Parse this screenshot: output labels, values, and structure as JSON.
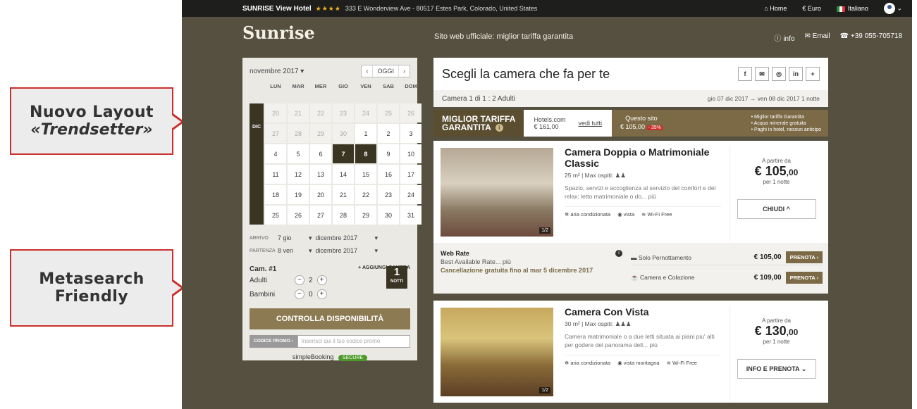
{
  "callouts": [
    {
      "line1": "Nuovo Layout",
      "line2": "«Trendsetter»"
    },
    {
      "line1": "Metasearch",
      "line2": "Friendly"
    }
  ],
  "topbar": {
    "hotel": "SUNRISE View Hotel",
    "stars": "★★★★",
    "address": "333 E Wonderview Ave - 80517 Estes Park, Colorado, United States",
    "home": "Home",
    "currency": "€ Euro",
    "language": "Italiano"
  },
  "header": {
    "logo": "Sunrise",
    "tagline": "Sito web ufficiale: miglior tariffa garantita",
    "info": "info",
    "email": "Email",
    "phone": "+39 055-705718"
  },
  "calendar": {
    "month_select": "novembre 2017",
    "today_btn": "OGGI",
    "prev": "‹",
    "next": "›",
    "dow": [
      "LUN",
      "MAR",
      "MER",
      "GIO",
      "VEN",
      "SAB",
      "DOM"
    ],
    "month_label": "DIC",
    "weeks": [
      [
        "20",
        "21",
        "22",
        "23",
        "24",
        "25",
        "26"
      ],
      [
        "27",
        "28",
        "29",
        "30",
        "1",
        "2",
        "3"
      ],
      [
        "4",
        "5",
        "6",
        "7",
        "8",
        "9",
        "10"
      ],
      [
        "11",
        "12",
        "13",
        "14",
        "15",
        "16",
        "17"
      ],
      [
        "18",
        "19",
        "20",
        "21",
        "22",
        "23",
        "24"
      ],
      [
        "25",
        "26",
        "27",
        "28",
        "29",
        "30",
        "31"
      ]
    ],
    "selected": [
      "7",
      "8"
    ]
  },
  "dates": {
    "arrivo_label": "ARRIVO",
    "arrivo_day": "7 gio",
    "arrivo_month": "dicembre 2017",
    "partenza_label": "PARTENZA",
    "partenza_day": "8 ven",
    "partenza_month": "dicembre 2017",
    "nights_num": "1",
    "nights_label": "NOTTI"
  },
  "room_form": {
    "room_label": "Cam. #1",
    "add_room": "+ AGGIUNGI CAMERA",
    "adults_label": "Adulti",
    "adults": "2",
    "children_label": "Bambini",
    "children": "0",
    "check_btn": "CONTROLLA DISPONIBILITÀ",
    "promo_label": "CODICE PROMO ›",
    "promo_placeholder": "Inserisci qui il tuo codice promo",
    "powered": "simpleBooking",
    "secure": "SECURE"
  },
  "main": {
    "title": "Scegli la camera che fa per te",
    "share": [
      "f",
      "✉",
      "◎",
      "in",
      "+"
    ],
    "summary_left": "Camera 1 di 1 : 2 Adulti",
    "summary_right": "gio 07 dic 2017 → ven 08 dic 2017   1 notte"
  },
  "banner": {
    "line1": "MIGLIOR TARIFFA",
    "line2": "GARANTITA",
    "hc_name": "Hotels.com",
    "hc_price": "€ 161,00",
    "link": "vedi tutti",
    "site_label": "Questo sito",
    "site_price": "€ 105,00",
    "discount": "- 35%",
    "bullets": [
      "• Miglior tariffa Garantita",
      "• Acqua minerale gratuita",
      "• Paghi in hotel, nessun anticipo"
    ]
  },
  "rooms": [
    {
      "name": "Camera Doppia o Matrimoniale Classic",
      "meta": "25 m²  |  Max ospiti:",
      "desc": "Spazio, servizi e accoglienza al servizio del comfort e del relax: letto matrimoniale o do... più",
      "amenities": [
        "❄ aria condizionata",
        "◉ vista",
        "Wi-Fi Free"
      ],
      "from": "A partire da",
      "price": "€ 105",
      "cents": ",00",
      "per": "per 1 notte",
      "button": "CHIUDI ^",
      "photo_count": "1/2"
    },
    {
      "name": "Camera Con Vista",
      "meta": "30 m²  |  Max ospiti:",
      "desc": "Camera matrimoniale o a due letti situata ai piani piu' alti per godere del panorama dell... più",
      "amenities": [
        "❄ aria condizionata",
        "◉ vista montagna",
        "Wi-Fi Free"
      ],
      "from": "A partire da",
      "price": "€ 130",
      "cents": ",00",
      "per": "per 1 notte",
      "button": "INFO E PRENOTA ⌄",
      "photo_count": "1/2"
    }
  ],
  "rates": {
    "name": "Web Rate",
    "sub": "Best Available Rate... più",
    "cancel": "Cancellazione gratuita fino al mar 5 dicembre 2017",
    "options": [
      {
        "label": "Solo Pernottamento",
        "price": "€ 105,00",
        "btn": "PRENOTA ›"
      },
      {
        "label": "Camera e Colazione",
        "price": "€ 109,00",
        "btn": "PRENOTA ›"
      }
    ]
  }
}
